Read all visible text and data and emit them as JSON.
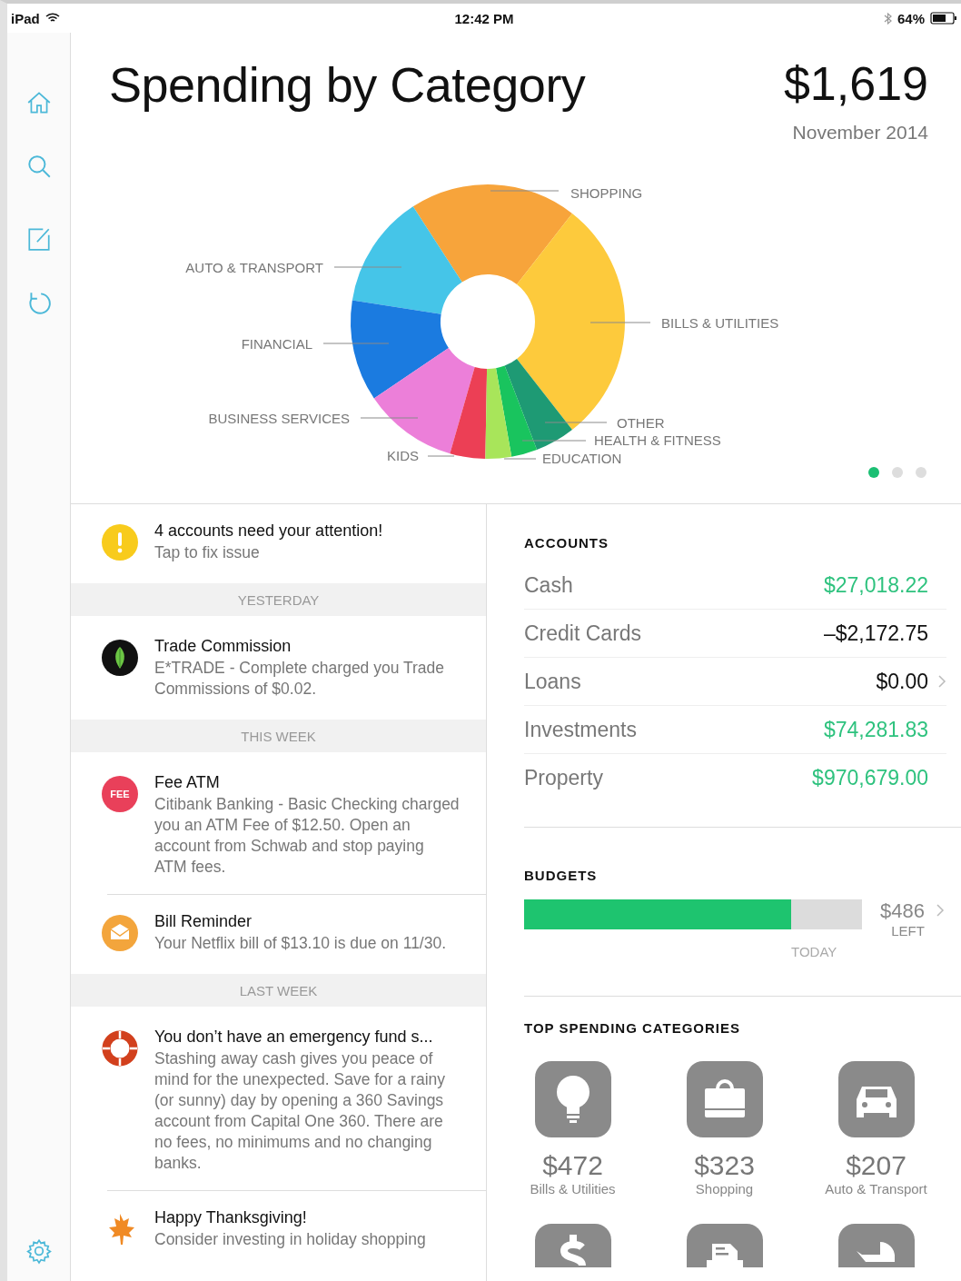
{
  "status_bar": {
    "device": "iPad",
    "time": "12:42 PM",
    "battery": "64%"
  },
  "sidebar": {
    "items": [
      {
        "kind": "home"
      },
      {
        "kind": "search"
      },
      {
        "kind": "compose"
      },
      {
        "kind": "refresh"
      }
    ],
    "footer": {
      "kind": "settings"
    }
  },
  "header": {
    "title": "Spending by Category",
    "total": "$1,619",
    "period": "November 2014"
  },
  "spending_chart": {
    "categories": [
      {
        "label": "SHOPPING",
        "color": "#f7a43b"
      },
      {
        "label": "AUTO & TRANSPORT",
        "color": "#45c5e8"
      },
      {
        "label": "BILLS & UTILITIES",
        "color": "#fdca3c"
      },
      {
        "label": "FINANCIAL",
        "color": "#1b7be0"
      },
      {
        "label": "BUSINESS SERVICES",
        "color": "#ec7fd9"
      },
      {
        "label": "OTHER",
        "color": "#1e9a74"
      },
      {
        "label": "HEALTH & FITNESS",
        "color": "#19c45e"
      },
      {
        "label": "KIDS",
        "color": "#ec3f55"
      },
      {
        "label": "EDUCATION",
        "color": "#a8e55a"
      }
    ]
  },
  "pager": [
    {
      "selected": true
    },
    {
      "selected": false
    },
    {
      "selected": false
    }
  ],
  "feed": [
    {
      "kind": "alert",
      "title": "4 accounts need your attention!",
      "body": "Tap to fix issue"
    },
    {
      "kind": "header",
      "label": "YESTERDAY"
    },
    {
      "kind": "leaf",
      "title": "Trade Commission",
      "body": "E*TRADE - Complete charged you Trade Commissions of $0.02."
    },
    {
      "kind": "header",
      "label": "THIS WEEK"
    },
    {
      "kind": "fee",
      "badge": "FEE",
      "title": "Fee ATM",
      "body": "Citibank Banking - Basic Checking charged you an ATM Fee of $12.50. Open an account from Schwab and stop paying ATM fees."
    },
    {
      "kind": "divider"
    },
    {
      "kind": "envelope",
      "title": "Bill Reminder",
      "body": "Your Netflix bill of $13.10 is due on 11/30."
    },
    {
      "kind": "header",
      "label": "LAST WEEK"
    },
    {
      "kind": "lifebuoy",
      "title": "You don’t have an emergency fund s...",
      "body": "Stashing away cash gives you peace of mind for the unexpected. Save for a rainy (or sunny) day by opening a 360 Savings account from Capital One 360. There are no fees, no minimums and no changing banks."
    },
    {
      "kind": "divider"
    },
    {
      "kind": "maple-leaf",
      "title": "Happy Thanksgiving!",
      "body": "Consider investing in holiday shopping"
    }
  ],
  "accounts": {
    "title": "ACCOUNTS",
    "rows": [
      {
        "name": "Cash",
        "value": "$27,018.22",
        "color": "#2ec27e",
        "chevron": false
      },
      {
        "name": "Credit Cards",
        "value": "–$2,172.75",
        "color": "#111111",
        "chevron": false
      },
      {
        "name": "Loans",
        "value": "$0.00",
        "color": "#111111",
        "chevron": true
      },
      {
        "name": "Investments",
        "value": "$74,281.83",
        "color": "#2ec27e",
        "chevron": false
      },
      {
        "name": "Property",
        "value": "$970,679.00",
        "color": "#2ec27e",
        "chevron": false
      }
    ]
  },
  "budgets": {
    "title": "BUDGETS",
    "level": 0.79,
    "marker_label": "TODAY",
    "amount": "$486",
    "amount_label": "LEFT"
  },
  "top_spending": {
    "title": "TOP SPENDING CATEGORIES",
    "tiles": [
      {
        "kind": "bulb",
        "amount": "$472",
        "label": "Bills & Utilities"
      },
      {
        "kind": "bag",
        "amount": "$323",
        "label": "Shopping"
      },
      {
        "kind": "car",
        "amount": "$207",
        "label": "Auto & Transport"
      },
      {
        "kind": "dollar"
      },
      {
        "kind": "document"
      },
      {
        "kind": "stroller"
      }
    ]
  }
}
